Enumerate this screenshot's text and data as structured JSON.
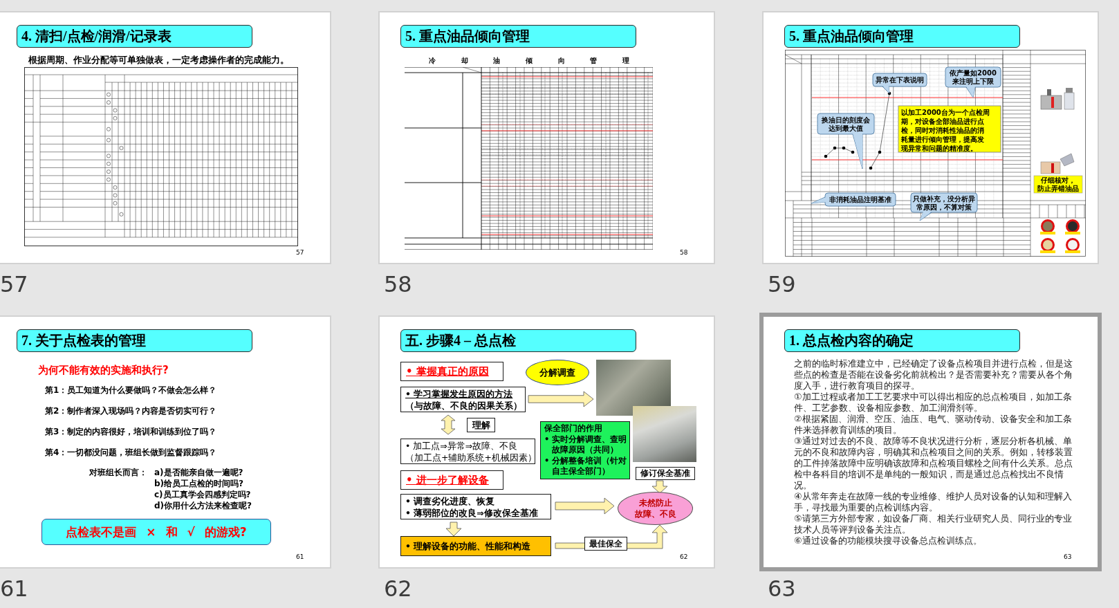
{
  "slides": [
    {
      "kind": "checklist",
      "number": "57",
      "selected": false,
      "title": "4. 清扫/点检/润滑/记录表",
      "subtitle": "根据周期、作业分配等可单独做表，一定考虑操作者的完成能力。",
      "page_number": "57"
    },
    {
      "kind": "trend_sheet",
      "number": "58",
      "selected": false,
      "title": "5. 重点油品倾向管理",
      "heading": "冷 却 油 倾 向 管 理",
      "page_number": "58"
    },
    {
      "kind": "trend_chart",
      "number": "59",
      "selected": false,
      "title": "5. 重点油品倾向管理",
      "annotations": [
        {
          "kind": "callout",
          "lines": [
            "异常在下表说明"
          ]
        },
        {
          "kind": "callout",
          "lines": [
            "依产量如2000",
            "来注明上下限"
          ]
        },
        {
          "kind": "callout",
          "lines": [
            "换油日的刻度会",
            "达到最大值"
          ]
        },
        {
          "kind": "note",
          "lines": [
            "以加工2000台为一个点检周",
            "期，对设备全部油品进行点",
            "检，同时对消耗性油品的消",
            "耗量进行倾向管理，提高发",
            "现异常和问题的精准度。"
          ]
        },
        {
          "kind": "label",
          "lines": [
            "仔细核对，",
            "防止弄错油品"
          ]
        },
        {
          "kind": "callout",
          "lines": [
            "非消耗油品注明基准"
          ]
        },
        {
          "kind": "callout",
          "lines": [
            "只做补充，没分析异",
            "常原因，不算对策"
          ]
        }
      ]
    },
    {
      "kind": "questions",
      "number": "61",
      "selected": false,
      "title": "7. 关于点检表的管理",
      "question": "为何不能有效的实施和执行?",
      "items": [
        "第1：员工知道为什么要做吗？不做会怎么样？",
        "第2：制作者深入现场吗？内容是否切实可行？",
        "第3：制定的内容很好，培训和训练到位了吗？",
        "第4：一切都没问题，班组长做到监督跟踪吗？"
      ],
      "leader_label": "对班组长而言：",
      "leader_items": [
        "a)是否能亲自做一遍呢?",
        "b)给员工点检的时间吗?",
        "c)员工真学会四感判定吗?",
        "d)你用什么方法来检查呢?"
      ],
      "banner": "点检表不是画 × 和 √ 的游戏?",
      "page_number": "61"
    },
    {
      "kind": "flow",
      "number": "62",
      "selected": false,
      "title": "五. 步骤4 – 总点检",
      "cause_heading": "• 掌握真正的原因",
      "method": [
        "• 学习掌握发生原因的方法",
        "（与故障、不良的因果关系）"
      ],
      "understand": "理解",
      "process": [
        "• 加工点⇒异常⇒故障、不良",
        "（加工点+辅助系统+机械因素）"
      ],
      "equipment_heading": "• 进一步了解设备",
      "actions": [
        "• 调查劣化进度、恢复",
        "• 薄弱部位的改良⇒修改保全基准"
      ],
      "function": "• 理解设备的功能、性能和构造",
      "investigate": "分解调查",
      "dept_title": "保全部门的作用",
      "dept_items": [
        "• 实时分解调查、查明故障原因（共同）",
        "• 分解整备培训（针对自主保全部门）"
      ],
      "revise": "修订保全基准",
      "goal": [
        "未然防止",
        "故障、不良"
      ],
      "best": "最佳保全",
      "page_number": "62"
    },
    {
      "kind": "text",
      "number": "63",
      "selected": true,
      "title": "1. 总点检内容的确定",
      "paragraphs": [
        "之前的临时标准建立中，已经确定了设备点检项目并进行点检，但是这些点的检查是否能在设备劣化前就检出？是否需要补充？需要从各个角度入手，进行教育项目的探寻。",
        "①加工过程或者加工工艺要求中可以得出相应的总点检项目，如加工条件、工艺参数、设备相应参数、加工润滑剂等。",
        "②根据紧固、润滑、空压、油压、电气、驱动传动、设备安全和加工条件来选择教育训练的项目。",
        "③通过对过去的不良、故障等不良状况进行分析，逐层分析各机械、单元的不良和故障内容，明确其和点检项目之间的关系。例如，转移装置的工件掉落故障中应明确该故障和点检项目螺栓之间有什么关系。总点检中各科目的培训不是单纯的一般知识，而是通过总点检找出不良情况。",
        "④从常年奔走在故障一线的专业维修、维护人员对设备的认知和理解入手，寻找最为重要的点检训练内容。",
        "⑤请第三方外部专家，如设备厂商、相关行业研究人员、同行业的专业技术人员等评判设备关注点。",
        "⑥通过设备的功能模块搜寻设备总点检训练点。"
      ],
      "page_number": "63"
    }
  ]
}
